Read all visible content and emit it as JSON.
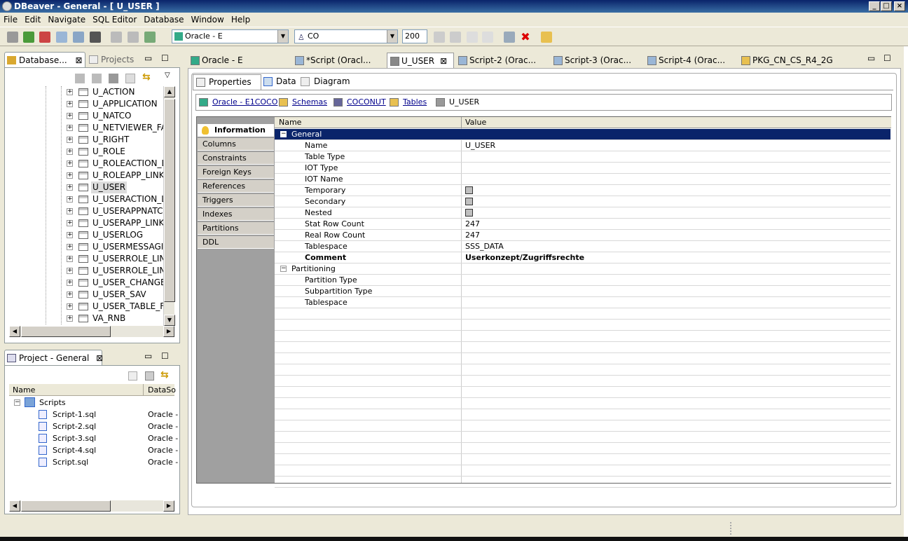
{
  "window": {
    "title": "DBeaver - General - [ U_USER ]",
    "min": "_",
    "max": "□",
    "close": "×"
  },
  "menu": [
    "File",
    "Edit",
    "Navigate",
    "SQL Editor",
    "Database",
    "Window",
    "Help"
  ],
  "toolbar": {
    "connection": "Oracle - E",
    "schema": "CO",
    "limit": "200"
  },
  "db_panel": {
    "tabs": [
      {
        "label": "Database..."
      },
      {
        "label": "Projects"
      }
    ],
    "tables": [
      "U_ACTION",
      "U_APPLICATION",
      "U_NATCO",
      "U_NETVIEWER_FAV",
      "U_RIGHT",
      "U_ROLE",
      "U_ROLEACTION_LIN",
      "U_ROLEAPP_LINK",
      "U_USER",
      "U_USERACTION_LIN",
      "U_USERAPPNATCO",
      "U_USERAPP_LINK",
      "U_USERLOG",
      "U_USERMESSAGIN",
      "U_USERROLE_LINK",
      "U_USERROLE_LINK",
      "U_USER_CHANGES",
      "U_USER_SAV",
      "U_USER_TABLE_FIL",
      "VA_RNB"
    ],
    "selected": "U_USER"
  },
  "project_panel": {
    "title": "Project - General",
    "columns": [
      "Name",
      "DataSo"
    ],
    "root": "Scripts",
    "scripts": [
      {
        "name": "Script-1.sql",
        "ds": "Oracle -"
      },
      {
        "name": "Script-2.sql",
        "ds": "Oracle -"
      },
      {
        "name": "Script-3.sql",
        "ds": "Oracle -"
      },
      {
        "name": "Script-4.sql",
        "ds": "Oracle -"
      },
      {
        "name": "Script.sql",
        "ds": "Oracle -"
      }
    ]
  },
  "editor_tabs": [
    {
      "label": "Oracle - E"
    },
    {
      "label": "*Script (Oracl..."
    },
    {
      "label": "U_USER"
    },
    {
      "label": "Script-2 (Orac..."
    },
    {
      "label": "Script-3 (Orac..."
    },
    {
      "label": "Script-4 (Orac..."
    },
    {
      "label": "PKG_CN_CS_R4_2G"
    }
  ],
  "sub_tabs": [
    "Properties",
    "Data",
    "Diagram"
  ],
  "breadcrumb": [
    "Oracle - E1COCO",
    "Schemas",
    "COCONUT",
    "Tables",
    "U_USER"
  ],
  "nav_items": [
    "Information",
    "Columns",
    "Constraints",
    "Foreign Keys",
    "References",
    "Triggers",
    "Indexes",
    "Partitions",
    "DDL"
  ],
  "props": {
    "col_name": "Name",
    "col_value": "Value",
    "group_general": "General",
    "group_partitioning": "Partitioning",
    "general": [
      {
        "name": "Name",
        "value": "U_USER"
      },
      {
        "name": "Table Type",
        "value": ""
      },
      {
        "name": "IOT Type",
        "value": ""
      },
      {
        "name": "IOT Name",
        "value": ""
      },
      {
        "name": "Temporary",
        "value": ""
      },
      {
        "name": "Secondary",
        "value": ""
      },
      {
        "name": "Nested",
        "value": ""
      },
      {
        "name": "Stat Row Count",
        "value": "247"
      },
      {
        "name": "Real Row Count",
        "value": "247"
      },
      {
        "name": "Tablespace",
        "value": "SSS_DATA"
      },
      {
        "name": "Comment",
        "value": "Userkonzept/Zugriffsrechte"
      }
    ],
    "partitioning": [
      {
        "name": "Partition Type",
        "value": ""
      },
      {
        "name": "Subpartition Type",
        "value": ""
      },
      {
        "name": "Tablespace",
        "value": ""
      }
    ]
  }
}
